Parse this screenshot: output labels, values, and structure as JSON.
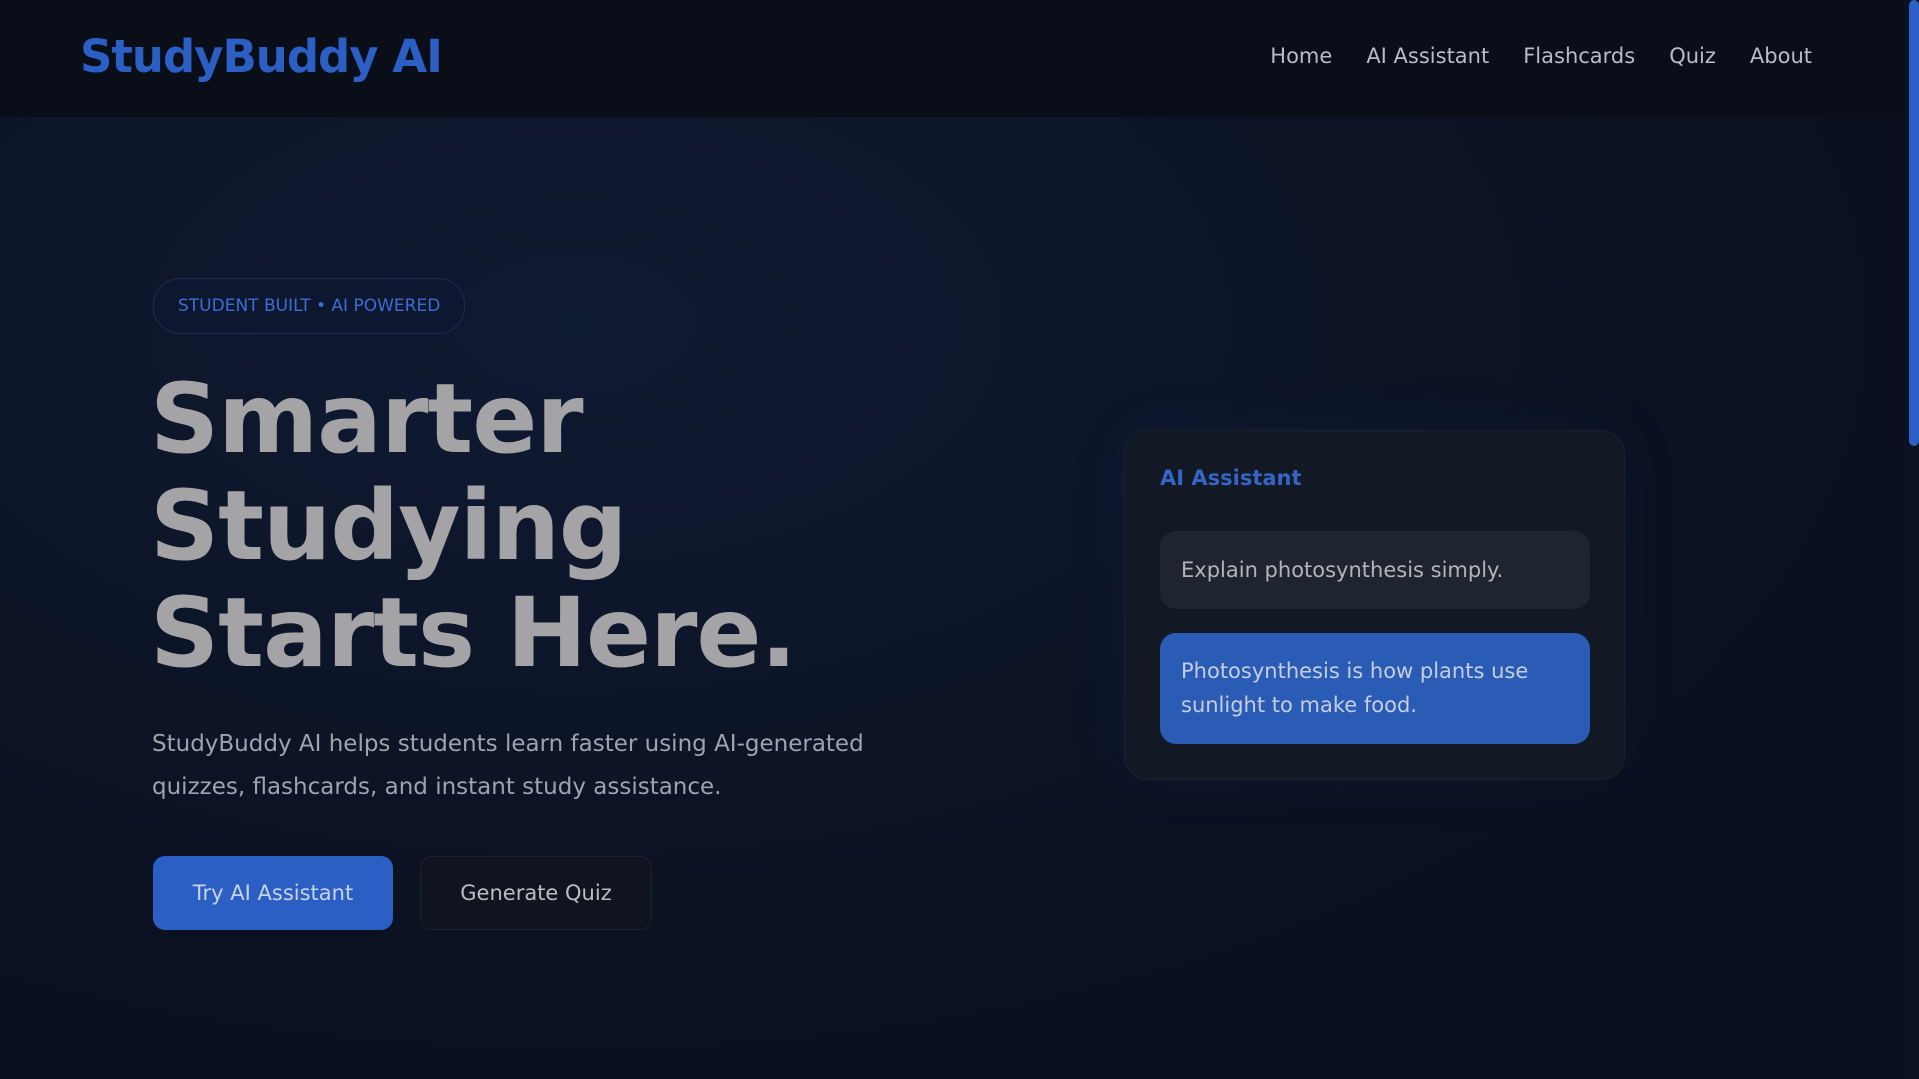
{
  "header": {
    "logo": "StudyBuddy AI",
    "nav": [
      "Home",
      "AI Assistant",
      "Flashcards",
      "Quiz",
      "About"
    ]
  },
  "hero": {
    "badge": "STUDENT BUILT • AI POWERED",
    "headline": [
      "Smarter",
      "Studying",
      "Starts Here."
    ],
    "subtext": "StudyBuddy AI helps students learn faster using AI-generated quizzes, flashcards, and instant study assistance.",
    "primary_button": "Try AI Assistant",
    "secondary_button": "Generate Quiz"
  },
  "assistant_card": {
    "title": "AI Assistant",
    "user_message": "Explain photosynthesis simply.",
    "ai_message": "Photosynthesis is how plants use sunlight to make food."
  },
  "colors": {
    "accent": "#2b5fc4",
    "background": "#0b1120",
    "card": "#121925"
  }
}
